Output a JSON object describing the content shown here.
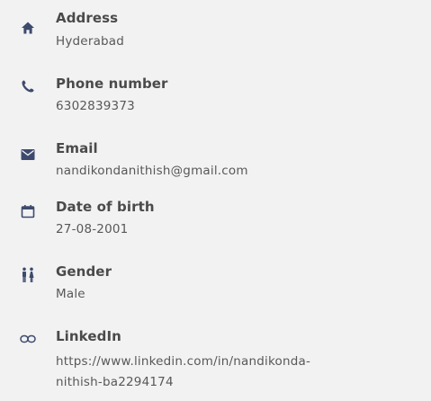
{
  "contact": {
    "address": {
      "label": "Address",
      "value": "Hyderabad",
      "icon": "home-icon"
    },
    "phone": {
      "label": "Phone number",
      "value": "6302839373",
      "icon": "phone-icon"
    },
    "email": {
      "label": "Email",
      "value": "nandikondanithish@gmail.com",
      "icon": "mail-icon"
    },
    "dob": {
      "label": "Date of birth",
      "value": "27-08-2001",
      "icon": "calendar-icon"
    },
    "gender": {
      "label": "Gender",
      "value": "Male",
      "icon": "gender-icon"
    },
    "linkedin": {
      "label": "LinkedIn",
      "value_line1": "https://www.linkedin.com/in/nandikonda-",
      "value_line2": "nithish-ba2294174",
      "icon": "link-icon"
    }
  },
  "colors": {
    "icon_color": "#3d4a6e",
    "label_color": "#4a4a4a",
    "value_color": "#585858",
    "background": "#f2f2f2"
  }
}
